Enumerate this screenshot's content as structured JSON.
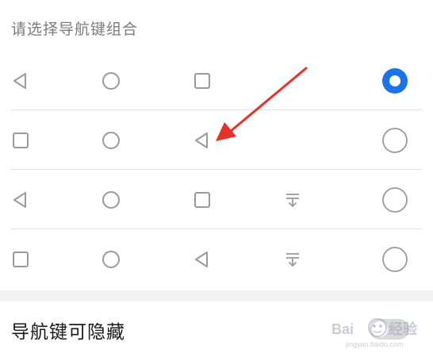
{
  "section": {
    "title": "请选择导航键组合"
  },
  "combos": [
    {
      "icons": [
        "back-triangle-icon",
        "home-circle-icon",
        "recent-square-icon"
      ],
      "selected": true
    },
    {
      "icons": [
        "recent-square-icon",
        "home-circle-icon",
        "back-triangle-icon"
      ],
      "selected": false
    },
    {
      "icons": [
        "back-triangle-icon",
        "home-circle-icon",
        "recent-square-icon",
        "notification-pulldown-icon"
      ],
      "selected": false
    },
    {
      "icons": [
        "recent-square-icon",
        "home-circle-icon",
        "back-triangle-icon",
        "notification-pulldown-icon"
      ],
      "selected": false
    }
  ],
  "hide_nav_setting": {
    "label": "导航键可隐藏",
    "enabled": false
  },
  "colors": {
    "accent": "#1a73e8",
    "icon": "#9a9a9a",
    "annotation": "#e8302b"
  },
  "watermark_text": "Baidu经验"
}
